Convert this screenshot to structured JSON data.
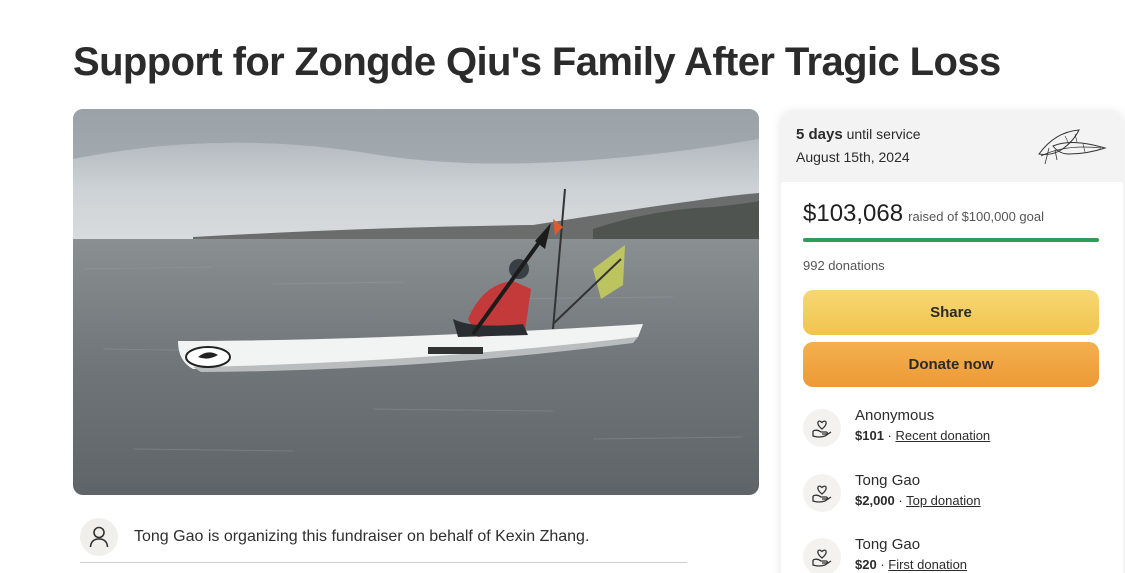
{
  "page": {
    "title": "Support for Zongde Qiu's Family After Tragic Loss"
  },
  "organizer": {
    "text": "Tong Gao is organizing this fundraiser on behalf of Kexin Zhang."
  },
  "sidebar": {
    "countdown_bold": "5 days",
    "countdown_rest": " until service",
    "service_date": "August 15th, 2024",
    "raised_amount": "$103,068",
    "raised_goal_text": "raised of $100,000 goal",
    "progress_fraction": 1.0,
    "donation_count": "992 donations",
    "share_label": "Share",
    "donate_label": "Donate now",
    "donors": [
      {
        "name": "Anonymous",
        "amount": "$101",
        "separator": " · ",
        "tag": "Recent donation"
      },
      {
        "name": "Tong Gao",
        "amount": "$2,000",
        "separator": " · ",
        "tag": "Top donation"
      },
      {
        "name": "Tong Gao",
        "amount": "$20",
        "separator": " · ",
        "tag": "First donation"
      }
    ]
  },
  "colors": {
    "progress": "#2f9c5b",
    "share_button": "#f3cb5c",
    "donate_button": "#efa33f"
  }
}
